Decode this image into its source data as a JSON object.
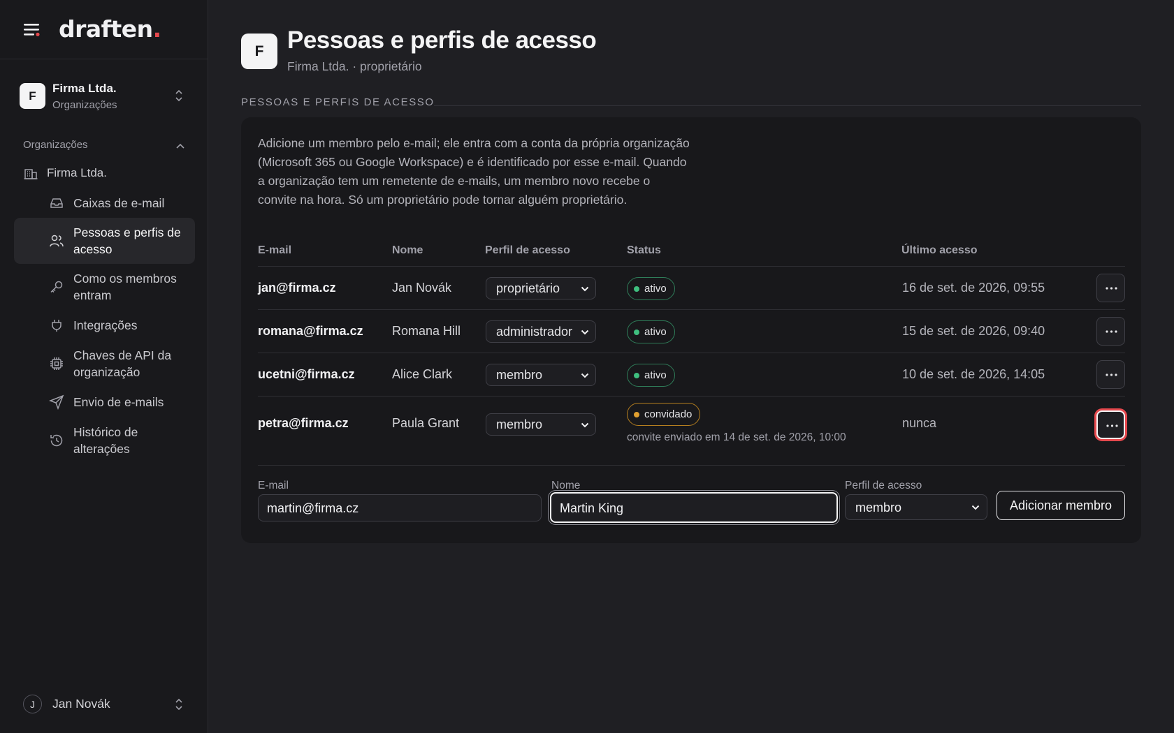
{
  "app": {
    "logo": "draften",
    "logo_dot": "."
  },
  "org_switcher": {
    "avatar": "F",
    "name": "Firma Ltda.",
    "subtitle": "Organizações"
  },
  "sidebar": {
    "section_label": "Organizações",
    "org_node": "Firma Ltda.",
    "items": [
      {
        "label": "Caixas de e-mail",
        "icon": "inbox-icon"
      },
      {
        "label": "Pessoas e perfis de acesso",
        "icon": "users-icon",
        "active": true
      },
      {
        "label": "Como os membros entram",
        "icon": "key-icon"
      },
      {
        "label": "Integrações",
        "icon": "plug-icon"
      },
      {
        "label": "Chaves de API da organização",
        "icon": "chip-icon"
      },
      {
        "label": "Envio de e-mails",
        "icon": "send-icon"
      },
      {
        "label": "Histórico de alterações",
        "icon": "history-icon"
      }
    ]
  },
  "user": {
    "avatar": "J",
    "name": "Jan Novák"
  },
  "page": {
    "avatar": "F",
    "title": "Pessoas e perfis de acesso",
    "subtitle": "Firma Ltda. · proprietário",
    "section_title": "PESSOAS E PERFIS DE ACESSO",
    "intro": "Adicione um membro pelo e-mail; ele entra com a conta da própria organização (Microsoft 365 ou Google Workspace) e é identificado por esse e-mail. Quando a organização tem um remetente de e-mails, um membro novo recebe o convite na hora. Só um proprietário pode tornar alguém proprietário."
  },
  "table": {
    "columns": [
      "E-mail",
      "Nome",
      "Perfil de acesso",
      "Status",
      "Último acesso"
    ],
    "rows": [
      {
        "email": "jan@firma.cz",
        "name": "Jan Novák",
        "role": "proprietário",
        "status": "ativo",
        "last": "16 de set. de 2026, 09:55"
      },
      {
        "email": "romana@firma.cz",
        "name": "Romana Hill",
        "role": "administrador",
        "status": "ativo",
        "last": "15 de set. de 2026, 09:40"
      },
      {
        "email": "ucetni@firma.cz",
        "name": "Alice Clark",
        "role": "membro",
        "status": "ativo",
        "last": "10 de set. de 2026, 14:05"
      },
      {
        "email": "petra@firma.cz",
        "name": "Paula Grant",
        "role": "membro",
        "status": "convidado",
        "note": "convite enviado em 14 de set. de 2026, 10:00",
        "last": "nunca"
      }
    ]
  },
  "form": {
    "email_label": "E-mail",
    "email_value": "martin@firma.cz",
    "name_label": "Nome",
    "name_value": "Martin King",
    "role_label": "Perfil de acesso",
    "role_value": "membro",
    "submit": "Adicionar membro"
  },
  "colors": {
    "accent_red": "#e5484d",
    "active_green": "#3fbf7f",
    "invited_amber": "#e0a030"
  }
}
